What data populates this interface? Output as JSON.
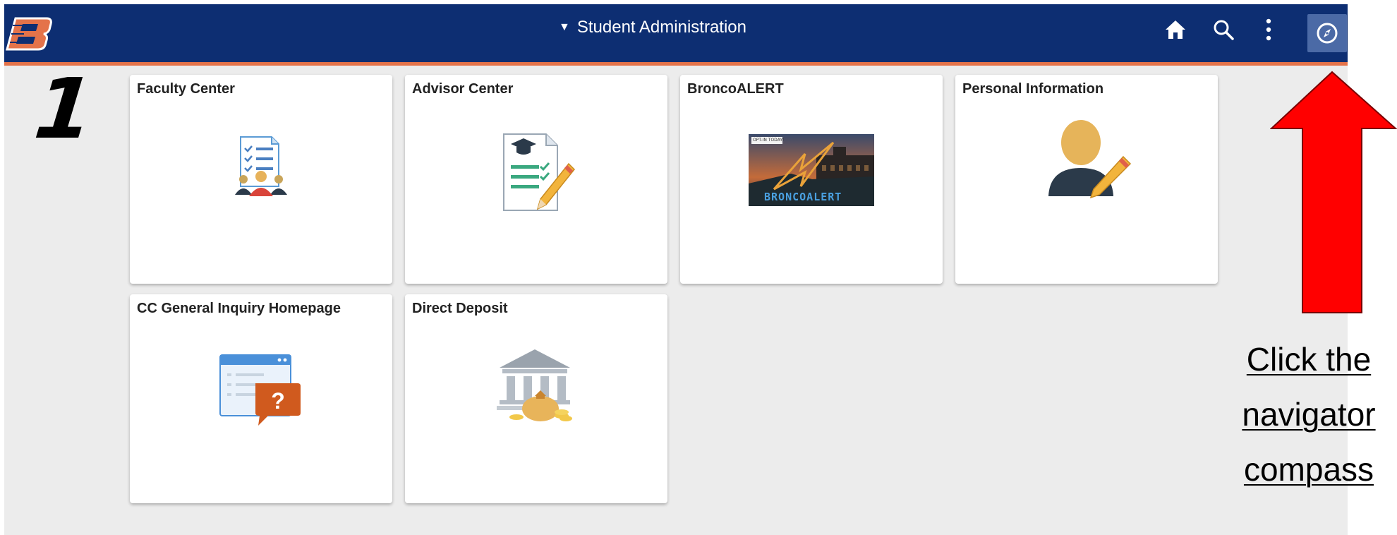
{
  "banner": {
    "title": "Student Administration",
    "logo_letter": "B",
    "buttons": {
      "home": "home-icon",
      "search": "search-icon",
      "actions": "more-vertical-icon",
      "navigator": "compass-icon"
    },
    "colors": {
      "background": "#0d2e72",
      "accent": "#e4734a",
      "navigator_bg": "#4b6aa6"
    }
  },
  "tiles": [
    {
      "title": "Faculty Center",
      "icon": "faculty-center-icon"
    },
    {
      "title": "Advisor Center",
      "icon": "advisor-center-icon"
    },
    {
      "title": "BroncoALERT",
      "icon": "broncoalert-image",
      "image_text": "BRONCOALERT",
      "image_small_text": "OPT-IN TODAY!"
    },
    {
      "title": "Personal Information",
      "icon": "personal-information-icon"
    },
    {
      "title": "CC General Inquiry Homepage",
      "icon": "general-inquiry-icon"
    },
    {
      "title": "Direct Deposit",
      "icon": "direct-deposit-icon"
    }
  ],
  "annotation": {
    "step_number": "1",
    "lines": [
      "Click the",
      "navigator",
      "compass"
    ],
    "arrow_color": "#ff0000"
  }
}
